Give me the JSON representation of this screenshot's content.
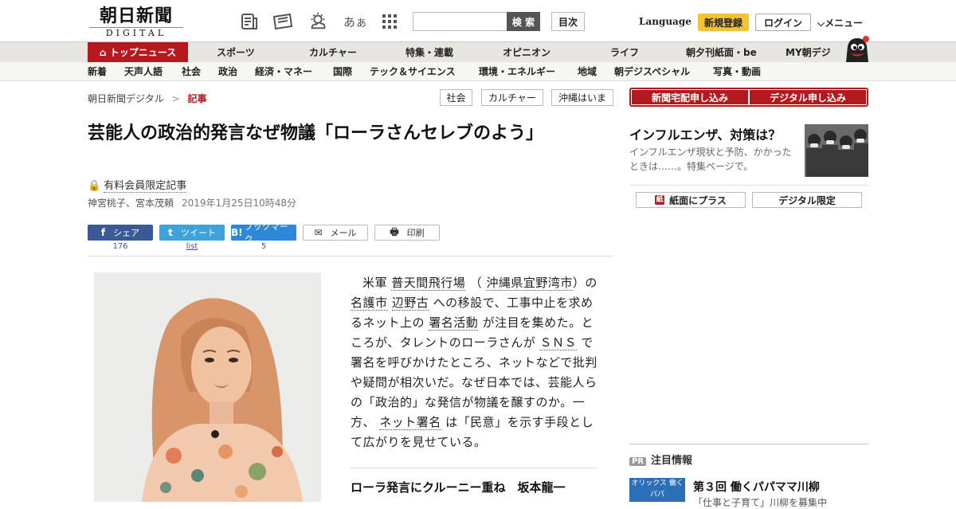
{
  "header": {
    "logo_jp": "朝日新聞",
    "logo_en": "DIGITAL",
    "icons": [
      "news-icon",
      "newspaper-icon",
      "weather-icon",
      "font-size-icon",
      "grid-icon"
    ],
    "font_icon_text": "あぁ",
    "search_placeholder": "",
    "search_button": "検 索",
    "toc_button": "目次",
    "language": "Language",
    "register": "新規登録",
    "login": "ログイン",
    "menu": "メニュー"
  },
  "nav_primary": [
    {
      "label": "トップニュース",
      "active": true
    },
    {
      "label": "スポーツ"
    },
    {
      "label": "カルチャー"
    },
    {
      "label": "特集・連載"
    },
    {
      "label": "オピニオン"
    },
    {
      "label": "ライフ"
    },
    {
      "label": "朝夕刊紙面・be"
    },
    {
      "label": "MY朝デジ"
    }
  ],
  "nav_secondary": [
    "新着",
    "天声人語",
    "社会",
    "政治",
    "経済・マネー",
    "国際",
    "テック＆サイエンス",
    "環境・エネルギー",
    "地域",
    "朝デジスペシャル",
    "写真・動画"
  ],
  "breadcrumb": {
    "home": "朝日新聞デジタル",
    "separator": ">",
    "current": "記事"
  },
  "tags": [
    "社会",
    "カルチャー",
    "沖縄はいま"
  ],
  "article": {
    "headline": "芸能人の政治的発言なぜ物議「ローラさんセレブのよう」",
    "member_label": "有料会員限定記事",
    "authors": "神宮桃子、宮本茂頼",
    "date": "2019年1月25日10時48分",
    "body": {
      "p1": "米軍",
      "kw1": "普天間飛行場",
      "p2": "（",
      "kw2": "沖縄県宜野湾市",
      "p3": "）の",
      "kw3": "名護市",
      "kw4": "辺野古",
      "p4": "への移設で、工事中止を求めるネット上の",
      "kw5": "署名活動",
      "p5": "が注目を集めた。ところが、タレントのローラさんが",
      "kw6": "ＳＮＳ",
      "p6": "で署名を呼びかけたところ、ネットなどで批判や疑問が相次いだ。なぜ日本では、芸能人らの「政治的」な発信が物議を醸すのか。一方、",
      "kw7": "ネット署名",
      "p7": "は「民意」を示す手段として広がりを見せている。"
    },
    "related_headline": "ローラ発言にクルーニー重ね　坂本龍一"
  },
  "share": {
    "facebook": {
      "label": "シェア",
      "icon": "f",
      "count": "176"
    },
    "twitter": {
      "label": "ツイート",
      "icon": "t",
      "count": "list"
    },
    "hatena": {
      "label": "ブックマーク",
      "icon": "B!",
      "count": "5"
    },
    "mail": {
      "label": "メール"
    },
    "print": {
      "label": "印刷"
    }
  },
  "sidebar": {
    "subscribe_paper": "新聞宅配申し込み",
    "subscribe_digital": "デジタル申し込み",
    "feature_title": "インフルエンザ、対策は？",
    "feature_desc": "インフルエンザ現状と予防、かかったときは……。特集ページで。",
    "paper_plus": "紙面にプラス",
    "paper_plus_icon": "紙",
    "digital_only": "デジタル限定",
    "pr_badge": "PR",
    "pr_heading": "注目情報",
    "pr_title": "第３回 働くパパママ川柳",
    "pr_sub": "「仕事と子育て」川柳を募集中",
    "pr_img_text": "オリックス 働くパパ"
  },
  "colors": {
    "brand_red": "#b5191e",
    "register_yellow": "#f5c235",
    "facebook": "#3b5998",
    "twitter": "#3ea3dc",
    "hatena": "#2c88d9"
  }
}
